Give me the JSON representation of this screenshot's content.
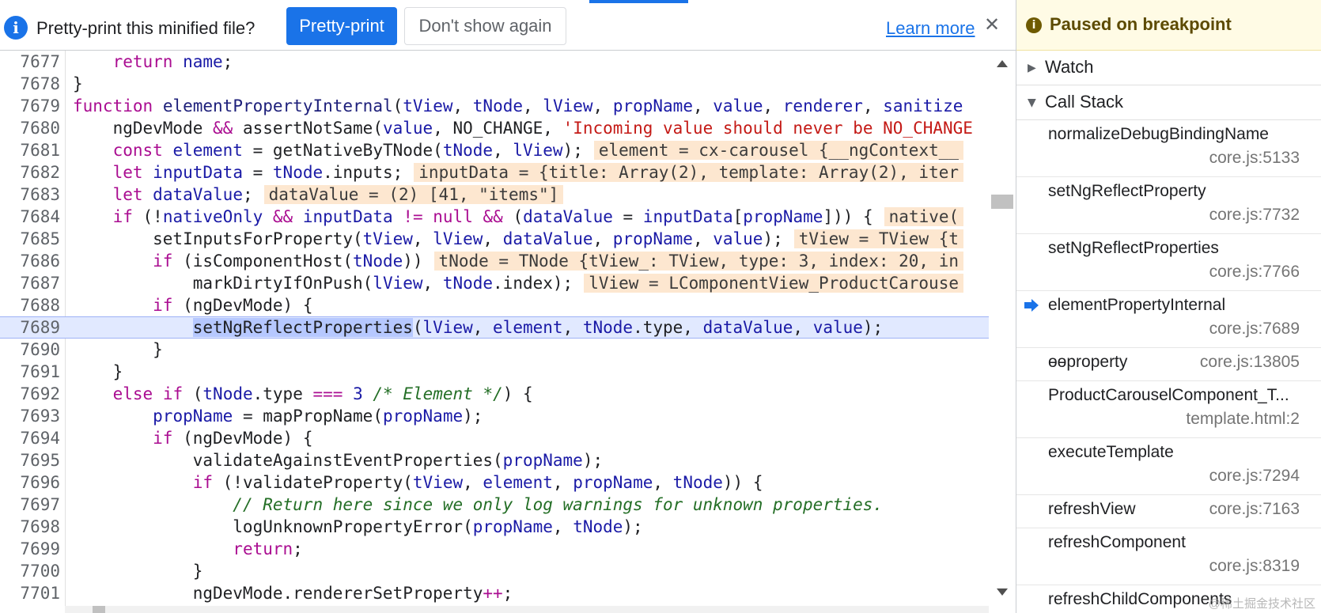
{
  "banner": {
    "prompt": "Pretty-print this minified file?",
    "pretty_print_label": "Pretty-print",
    "dont_show_label": "Don't show again",
    "learn_more_label": "Learn more",
    "close_glyph": "✕",
    "info_glyph": "i"
  },
  "editor": {
    "lines": [
      {
        "num": "7677"
      },
      {
        "num": "7678"
      },
      {
        "num": "7679"
      },
      {
        "num": "7680"
      },
      {
        "num": "7681"
      },
      {
        "num": "7682"
      },
      {
        "num": "7683"
      },
      {
        "num": "7684"
      },
      {
        "num": "7685"
      },
      {
        "num": "7686"
      },
      {
        "num": "7687"
      },
      {
        "num": "7688"
      },
      {
        "num": "7689"
      },
      {
        "num": "7690"
      },
      {
        "num": "7691"
      },
      {
        "num": "7692"
      },
      {
        "num": "7693"
      },
      {
        "num": "7694"
      },
      {
        "num": "7695"
      },
      {
        "num": "7696"
      },
      {
        "num": "7697"
      },
      {
        "num": "7698"
      },
      {
        "num": "7699"
      },
      {
        "num": "7700"
      },
      {
        "num": "7701"
      }
    ],
    "t": {
      "l7677": [
        "    ",
        "return",
        " ",
        "name",
        ";"
      ],
      "l7678": [
        "}"
      ],
      "l7679": [
        "function",
        " ",
        "elementPropertyInternal",
        "(",
        "tView",
        ", ",
        "tNode",
        ", ",
        "lView",
        ", ",
        "propName",
        ", ",
        "value",
        ", ",
        "renderer",
        ", ",
        "sanitize"
      ],
      "l7680": [
        "    ngDevMode ",
        "&&",
        " assertNotSame(",
        "value",
        ", NO_CHANGE, ",
        "'Incoming value should never be NO_CHANGE"
      ],
      "l7681": [
        "    ",
        "const",
        " ",
        "element",
        " = getNativeByTNode(",
        "tNode",
        ", ",
        "lView",
        ");",
        "element = cx-carousel {__ngContext__"
      ],
      "l7682": [
        "    ",
        "let",
        " ",
        "inputData",
        " = ",
        "tNode",
        ".inputs;",
        "inputData = {title: Array(2), template: Array(2), iter"
      ],
      "l7683": [
        "    ",
        "let",
        " ",
        "dataValue",
        ";",
        "dataValue = (2) [41, \"items\"]"
      ],
      "l7684": [
        "    ",
        "if",
        " (!",
        "nativeOnly",
        " ",
        "&&",
        " ",
        "inputData",
        " ",
        "!=",
        " ",
        "null",
        " ",
        "&&",
        " (",
        "dataValue",
        " = ",
        "inputData",
        "[",
        "propName",
        "])) {",
        "native("
      ],
      "l7685": [
        "        setInputsForProperty(",
        "tView",
        ", ",
        "lView",
        ", ",
        "dataValue",
        ", ",
        "propName",
        ", ",
        "value",
        ");",
        "tView = TView {t"
      ],
      "l7686": [
        "        ",
        "if",
        " (isComponentHost(",
        "tNode",
        "))",
        "tNode = TNode {tView_: TView, type: 3, index: 20, in"
      ],
      "l7687": [
        "            markDirtyIfOnPush(",
        "lView",
        ", ",
        "tNode",
        ".index);",
        "lView = LComponentView_ProductCarouse"
      ],
      "l7688": [
        "        ",
        "if",
        " (ngDevMode) {"
      ],
      "l7689": [
        "            ",
        "setNgReflectProperties",
        "(",
        "lView",
        ", ",
        "element",
        ", ",
        "tNode",
        ".type, ",
        "dataValue",
        ", ",
        "value",
        ");"
      ],
      "l7690": [
        "        }"
      ],
      "l7691": [
        "    }"
      ],
      "l7692": [
        "    ",
        "else",
        " ",
        "if",
        " (",
        "tNode",
        ".type ",
        "===",
        " ",
        "3",
        " ",
        "/* Element */",
        ") {"
      ],
      "l7693": [
        "        ",
        "propName",
        " = mapPropName(",
        "propName",
        ");"
      ],
      "l7694": [
        "        ",
        "if",
        " (ngDevMode) {"
      ],
      "l7695": [
        "            validateAgainstEventProperties(",
        "propName",
        ");"
      ],
      "l7696": [
        "            ",
        "if",
        " (!validateProperty(",
        "tView",
        ", ",
        "element",
        ", ",
        "propName",
        ", ",
        "tNode",
        ")) {"
      ],
      "l7697": [
        "                ",
        "// Return here since we only log warnings for unknown properties."
      ],
      "l7698": [
        "                logUnknownPropertyError(",
        "propName",
        ", ",
        "tNode",
        ");"
      ],
      "l7699": [
        "                ",
        "return",
        ";"
      ],
      "l7700": [
        "            }"
      ],
      "l7701": [
        "            ngDevMode.rendererSetProperty",
        "++",
        ";"
      ]
    }
  },
  "debugger": {
    "paused_label": "Paused on breakpoint",
    "paused_glyph": "i",
    "watch_label": "Watch",
    "callstack_label": "Call Stack",
    "frames": [
      {
        "fn": "normalizeDebugBindingName",
        "loc": "core.js:5133"
      },
      {
        "fn": "setNgReflectProperty",
        "loc": "core.js:7732"
      },
      {
        "fn": "setNgReflectProperties",
        "loc": "core.js:7766"
      },
      {
        "fn": "elementPropertyInternal",
        "loc": "core.js:7689"
      },
      {
        "fn": "ɵɵproperty",
        "loc": "core.js:13805"
      },
      {
        "fn": "ProductCarouselComponent_T...",
        "loc": "template.html:2"
      },
      {
        "fn": "executeTemplate",
        "loc": "core.js:7294"
      },
      {
        "fn": "refreshView",
        "loc": "core.js:7163"
      },
      {
        "fn": "refreshComponent",
        "loc": "core.js:8319"
      },
      {
        "fn": "refreshChildComponents",
        "loc": ""
      }
    ],
    "watermark": "@稀土掘金技术社区"
  }
}
